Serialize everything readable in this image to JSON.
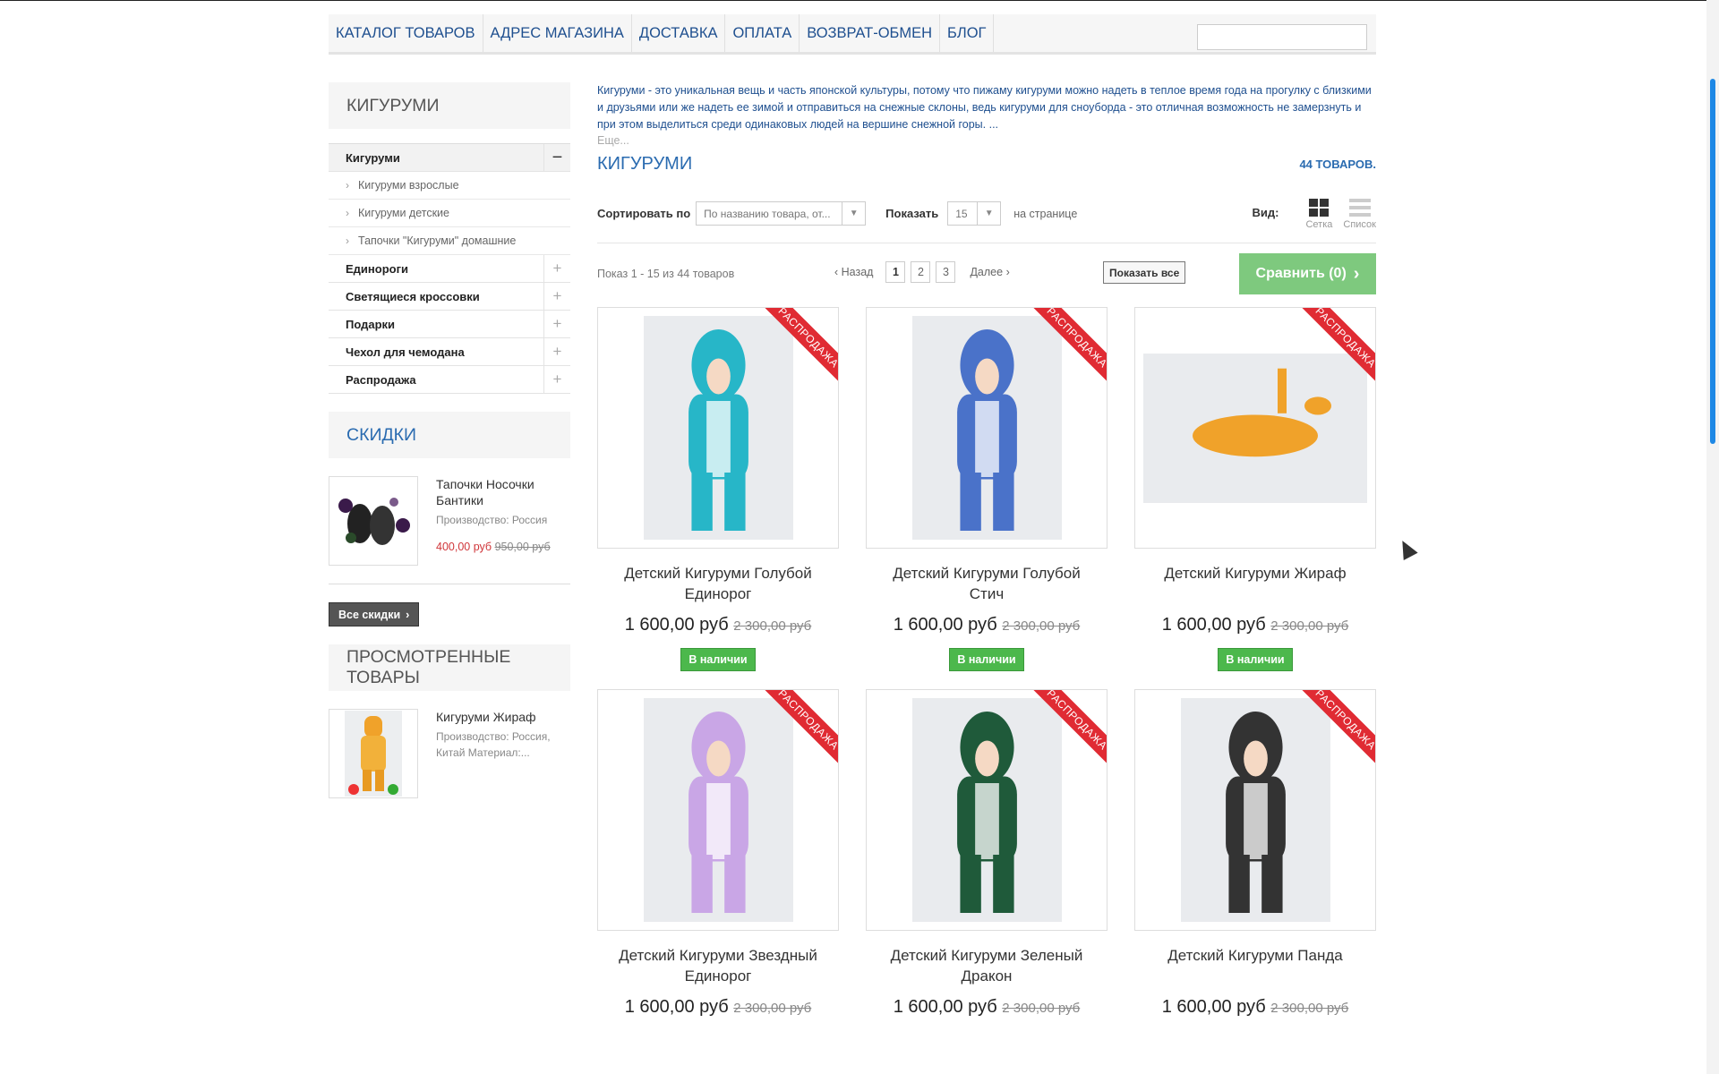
{
  "nav": {
    "items": [
      "КАТАЛОГ ТОВАРОВ",
      "АДРЕС МАГАЗИНА",
      "ДОСТАВКА",
      "ОПЛАТА",
      "ВОЗВРАТ-ОБМЕН",
      "БЛОГ"
    ],
    "search_placeholder": ""
  },
  "sidebar": {
    "category_title": "КИГУРУМИ",
    "categories": [
      {
        "label": "Кигуруми",
        "toggle": "−",
        "expanded": true,
        "children": [
          "Кигуруми взрослые",
          "Кигуруми детские",
          "Тапочки \"Кигуруми\" домашние"
        ]
      },
      {
        "label": "Единороги",
        "toggle": "+"
      },
      {
        "label": "Светящиеся кроссовки",
        "toggle": "+"
      },
      {
        "label": "Подарки",
        "toggle": "+"
      },
      {
        "label": "Чехол для чемодана",
        "toggle": "+"
      },
      {
        "label": "Распродажа",
        "toggle": "+"
      }
    ],
    "discounts": {
      "title": "СКИДКИ",
      "item": {
        "name": "Тапочки Носочки Бантики",
        "meta": "Производство: Россия",
        "price": "400,00 руб",
        "old_price": "950,00 руб"
      },
      "all_button": "Все скидки"
    },
    "viewed": {
      "title": "ПРОСМОТРЕННЫЕ ТОВАРЫ",
      "item": {
        "name": "Кигуруми Жираф",
        "meta": "Производство: Россия, Китай Материал:..."
      }
    }
  },
  "main": {
    "description": "Кигуруми - это уникальная вещь и часть японской культуры, потому что пижаму кигуруми можно надеть в теплое время года на прогулку с близкими и друзьями или же надеть ее зимой и отправиться на снежные склоны, ведь кигуруми для сноуборда - это отличная возможность не замерзнуть и при этом выделиться среди одинаковых людей на вершине снежной горы. ...",
    "more": "Еще...",
    "title": "КИГУРУМИ",
    "count": "44 ТОВАРОВ.",
    "sort_label": "Сортировать по",
    "sort_value": "По названию товара, от...",
    "show_label": "Показать",
    "show_value": "15",
    "per_page": "на странице",
    "view_label": "Вид:",
    "view_grid": "Сетка",
    "view_list": "Список",
    "shown_text": "Показ 1 - 15 из 44 товаров",
    "prev": "Назад",
    "pages": [
      "1",
      "2",
      "3"
    ],
    "current_page": "1",
    "next": "Далее",
    "show_all": "Показать все",
    "compare": "Сравнить (0)"
  },
  "products": [
    {
      "name": "Детский Кигуруми Голубой Единорог",
      "price": "1 600,00 руб",
      "old_price": "2 300,00 руб",
      "badge": "РАСПРОДАЖА",
      "stock": "В наличии",
      "photo": "tall",
      "color": "#27b6c8"
    },
    {
      "name": "Детский Кигуруми Голубой Стич",
      "price": "1 600,00 руб",
      "old_price": "2 300,00 руб",
      "badge": "РАСПРОДАЖА",
      "stock": "В наличии",
      "photo": "tall",
      "color": "#4a72c9"
    },
    {
      "name": "Детский Кигуруми Жираф",
      "price": "1 600,00 руб",
      "old_price": "2 300,00 руб",
      "badge": "РАСПРОДАЖА",
      "stock": "В наличии",
      "photo": "wide",
      "color": "#f0a22a"
    },
    {
      "name": "Детский Кигуруми Звездный Единорог",
      "price": "1 600,00 руб",
      "old_price": "2 300,00 руб",
      "badge": "РАСПРОДАЖА",
      "stock": "",
      "photo": "tall",
      "color": "#c9a6e6"
    },
    {
      "name": "Детский Кигуруми Зеленый Дракон",
      "price": "1 600,00 руб",
      "old_price": "2 300,00 руб",
      "badge": "РАСПРОДАЖА",
      "stock": "",
      "photo": "tall",
      "color": "#1f5a3a"
    },
    {
      "name": "Детский Кигуруми Панда",
      "price": "1 600,00 руб",
      "old_price": "2 300,00 руб",
      "badge": "РАСПРОДАЖА",
      "stock": "",
      "photo": "tall",
      "color": "#333333"
    }
  ],
  "colors": {
    "brand": "#2a6bb0",
    "sale": "#e02b33",
    "in_stock": "#4cb84c",
    "compare": "#7ec97e"
  }
}
